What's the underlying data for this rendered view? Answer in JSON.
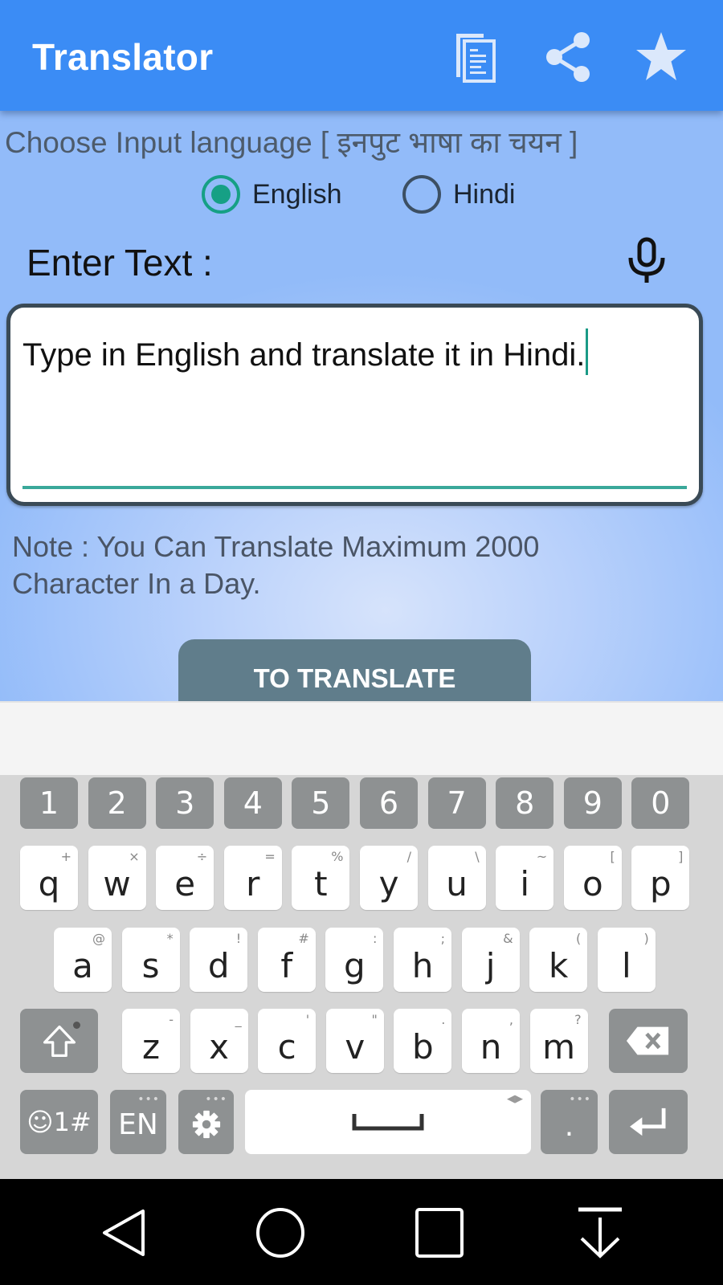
{
  "app_bar": {
    "title": "Translator",
    "actions": [
      {
        "name": "copy-icon",
        "label": "Copy"
      },
      {
        "name": "share-icon",
        "label": "Share"
      },
      {
        "name": "star-icon",
        "label": "Rate"
      }
    ],
    "color": "#3b8cf5"
  },
  "input_language": {
    "label": "Choose Input language [ इनपुट भाषा का चयन  ]",
    "options": [
      {
        "label": "English",
        "selected": true
      },
      {
        "label": "Hindi",
        "selected": false
      }
    ],
    "accent": "#16a085"
  },
  "enter_text": {
    "label": "Enter Text :",
    "mic_icon": "microphone-icon",
    "value": "Type in English and translate it in Hindi."
  },
  "note": {
    "text": "Note  :  You Can Translate Maximum 2000 Character In a Day."
  },
  "translate_button": {
    "label": "TO TRANSLATE",
    "color": "#607d8b"
  },
  "keyboard": {
    "number_row": [
      "1",
      "2",
      "3",
      "4",
      "5",
      "6",
      "7",
      "8",
      "9",
      "0"
    ],
    "row1": [
      {
        "key": "q",
        "sub": "+"
      },
      {
        "key": "w",
        "sub": "×"
      },
      {
        "key": "e",
        "sub": "÷"
      },
      {
        "key": "r",
        "sub": "="
      },
      {
        "key": "t",
        "sub": "%"
      },
      {
        "key": "y",
        "sub": "/"
      },
      {
        "key": "u",
        "sub": "\\"
      },
      {
        "key": "i",
        "sub": "~"
      },
      {
        "key": "o",
        "sub": "["
      },
      {
        "key": "p",
        "sub": "]"
      }
    ],
    "row2": [
      {
        "key": "a",
        "sub": "@"
      },
      {
        "key": "s",
        "sub": "*"
      },
      {
        "key": "d",
        "sub": "!"
      },
      {
        "key": "f",
        "sub": "#"
      },
      {
        "key": "g",
        "sub": ":"
      },
      {
        "key": "h",
        "sub": ";"
      },
      {
        "key": "j",
        "sub": "&"
      },
      {
        "key": "k",
        "sub": "("
      },
      {
        "key": "l",
        "sub": ")"
      }
    ],
    "row3": [
      {
        "key": "z",
        "sub": "-"
      },
      {
        "key": "x",
        "sub": "_"
      },
      {
        "key": "c",
        "sub": "'"
      },
      {
        "key": "v",
        "sub": "\""
      },
      {
        "key": "b",
        "sub": "."
      },
      {
        "key": "n",
        "sub": ","
      },
      {
        "key": "m",
        "sub": "?"
      }
    ],
    "shift_icon": "shift-icon",
    "backspace_icon": "backspace-icon",
    "symbols_label": "☺1#",
    "language_label": "EN",
    "settings_icon": "gear-icon",
    "space_icon": "space-icon",
    "period_label": ".",
    "enter_icon": "enter-icon",
    "more_dots": "•••",
    "space_arrows": "◀▶"
  },
  "nav_bar": {
    "buttons": [
      "back-icon",
      "home-icon",
      "recents-icon",
      "hide-keyboard-icon"
    ]
  }
}
